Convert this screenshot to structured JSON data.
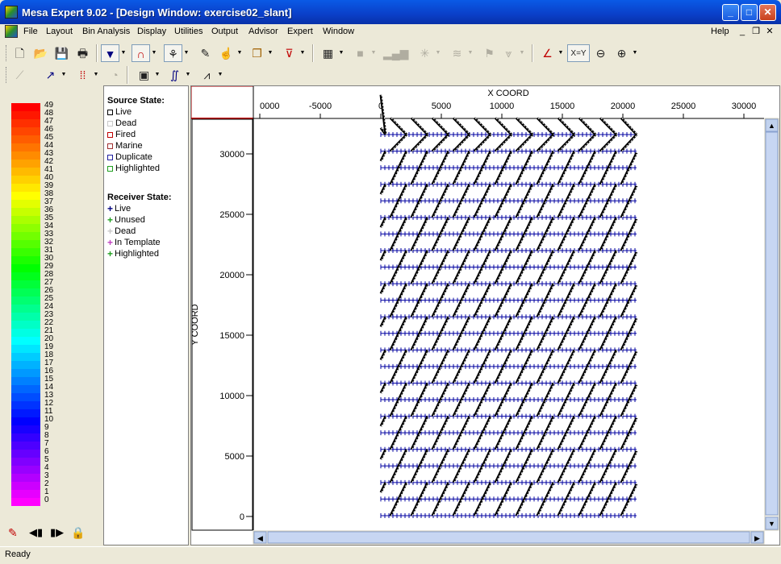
{
  "window": {
    "title": "Mesa Expert 9.02 - [Design Window: exercise02_slant]"
  },
  "menu": [
    "File",
    "Layout",
    "Bin Analysis",
    "Display",
    "Utilities",
    "Output",
    "Advisor",
    "Expert",
    "Window"
  ],
  "menu_help": "Help",
  "toolbar": {
    "xy_label": "X=Y"
  },
  "palette": {
    "labels": [
      "49",
      "48",
      "47",
      "46",
      "45",
      "44",
      "43",
      "42",
      "41",
      "40",
      "39",
      "38",
      "37",
      "36",
      "35",
      "34",
      "33",
      "32",
      "31",
      "30",
      "29",
      "28",
      "27",
      "26",
      "25",
      "24",
      "23",
      "22",
      "21",
      "20",
      "19",
      "18",
      "17",
      "16",
      "15",
      "14",
      "13",
      "12",
      "11",
      "10",
      "9",
      "8",
      "7",
      "6",
      "5",
      "4",
      "3",
      "2",
      "1",
      "0"
    ]
  },
  "legend": {
    "source_title": "Source State:",
    "source_items": [
      {
        "label": "Live",
        "color": "#000000"
      },
      {
        "label": "Dead",
        "color": "#c8c8c8"
      },
      {
        "label": "Fired",
        "color": "#c00000"
      },
      {
        "label": "Marine",
        "color": "#a03030"
      },
      {
        "label": "Duplicate",
        "color": "#2020a0"
      },
      {
        "label": "Highlighted",
        "color": "#20a020"
      }
    ],
    "receiver_title": "Receiver State:",
    "receiver_items": [
      {
        "label": "Live",
        "color": "#000080"
      },
      {
        "label": "Unused",
        "color": "#20a020"
      },
      {
        "label": "Dead",
        "color": "#c8c8c8"
      },
      {
        "label": "In Template",
        "color": "#c040c0"
      },
      {
        "label": "Highlighted",
        "color": "#20a020"
      }
    ]
  },
  "plot": {
    "xlabel": "X COORD",
    "ylabel": "Y COORD",
    "x_ticks": [
      "0000",
      "-5000",
      "0",
      "5000",
      "10000",
      "15000",
      "20000",
      "25000",
      "30000"
    ],
    "y_ticks": [
      "30000",
      "25000",
      "20000",
      "15000",
      "10000",
      "5000",
      "0"
    ],
    "receiver_color": "#0000a0",
    "source_color": "#000000"
  },
  "status": {
    "text": "Ready"
  }
}
